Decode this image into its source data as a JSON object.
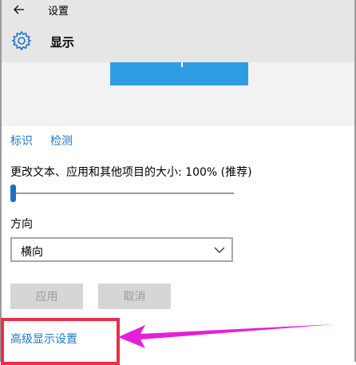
{
  "header": {
    "app_title": "设置",
    "page_title": "显示"
  },
  "display": {
    "identify_label": "标识",
    "detect_label": "检测",
    "scale_label": "更改文本、应用和其他项目的大小: 100% (推荐)",
    "scale_slider_fraction": 0.0,
    "orientation_label": "方向",
    "orientation_value": "横向",
    "apply_label": "应用",
    "cancel_label": "取消",
    "advanced_link": "高级显示设置"
  },
  "colors": {
    "accent": "#1a77c9",
    "monitor_preview": "#2e9de4",
    "highlight": "#e53045",
    "annotation_arrow": "#e41fd9"
  },
  "icons": [
    "back-arrow-icon",
    "gear-icon",
    "chevron-down-icon"
  ]
}
